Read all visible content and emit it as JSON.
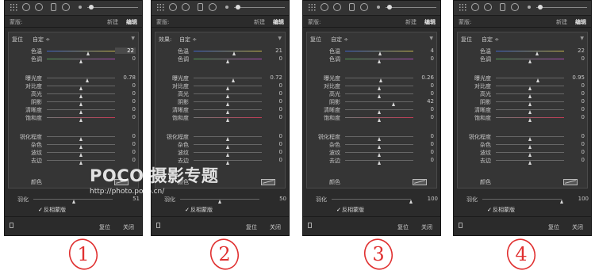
{
  "watermark": {
    "brand": "POCO 摄影专题",
    "url": "http://photo.poco.cn/"
  },
  "labels": {
    "mode": "蒙版:",
    "new": "新建",
    "edit": "编辑",
    "color": "颜色",
    "feather": "羽化",
    "invert": "反相蒙版",
    "reset": "复位",
    "close": "关闭",
    "dropdown": "自定 ÷"
  },
  "annotations": [
    "1",
    "2",
    "3",
    "4"
  ],
  "colors": {
    "panel_bg": "#2b2b2b",
    "effect_bg": "#353535",
    "annotation_red": "#e03030"
  },
  "panels": [
    {
      "effect_label": "复位",
      "effect_value": "自定 ÷",
      "sliders": [
        {
          "label": "色温",
          "value": "22",
          "pos": 0.61
        },
        {
          "label": "色调",
          "value": "0",
          "pos": 0.5
        },
        {
          "label": "曝光度",
          "value": "0.78",
          "pos": 0.6
        },
        {
          "label": "对比度",
          "value": "0",
          "pos": 0.5
        },
        {
          "label": "高光",
          "value": "0",
          "pos": 0.5
        },
        {
          "label": "阴影",
          "value": "0",
          "pos": 0.5
        },
        {
          "label": "清晰度",
          "value": "0",
          "pos": 0.5
        },
        {
          "label": "饱和度",
          "value": "0",
          "pos": 0.5
        },
        {
          "label": "锐化程度",
          "value": "0",
          "pos": 0.5
        },
        {
          "label": "杂色",
          "value": "0",
          "pos": 0.5
        },
        {
          "label": "波纹",
          "value": "0",
          "pos": 0.5
        },
        {
          "label": "去边",
          "value": "0",
          "pos": 0.5
        }
      ],
      "feather": {
        "value": "51",
        "pos": 0.51
      }
    },
    {
      "effect_label": "效果:",
      "effect_value": "自定 ÷",
      "sliders": [
        {
          "label": "色温",
          "value": "21",
          "pos": 0.6
        },
        {
          "label": "色调",
          "value": "0",
          "pos": 0.5
        },
        {
          "label": "曝光度",
          "value": "0.72",
          "pos": 0.59
        },
        {
          "label": "对比度",
          "value": "0",
          "pos": 0.5
        },
        {
          "label": "高光",
          "value": "0",
          "pos": 0.5
        },
        {
          "label": "阴影",
          "value": "0",
          "pos": 0.5
        },
        {
          "label": "清晰度",
          "value": "0",
          "pos": 0.5
        },
        {
          "label": "饱和度",
          "value": "0",
          "pos": 0.5
        },
        {
          "label": "锐化程度",
          "value": "0",
          "pos": 0.5
        },
        {
          "label": "杂色",
          "value": "0",
          "pos": 0.5
        },
        {
          "label": "波纹",
          "value": "0",
          "pos": 0.5
        },
        {
          "label": "去边",
          "value": "0",
          "pos": 0.5
        }
      ],
      "feather": {
        "value": "50",
        "pos": 0.5
      }
    },
    {
      "effect_label": "复位",
      "effect_value": "自定 ÷",
      "sliders": [
        {
          "label": "色温",
          "value": "4",
          "pos": 0.52
        },
        {
          "label": "色调",
          "value": "0",
          "pos": 0.5
        },
        {
          "label": "曝光度",
          "value": "0.26",
          "pos": 0.53
        },
        {
          "label": "对比度",
          "value": "0",
          "pos": 0.5
        },
        {
          "label": "高光",
          "value": "0",
          "pos": 0.5
        },
        {
          "label": "阴影",
          "value": "42",
          "pos": 0.71
        },
        {
          "label": "清晰度",
          "value": "0",
          "pos": 0.5
        },
        {
          "label": "饱和度",
          "value": "0",
          "pos": 0.5
        },
        {
          "label": "锐化程度",
          "value": "0",
          "pos": 0.5
        },
        {
          "label": "杂色",
          "value": "0",
          "pos": 0.5
        },
        {
          "label": "波纹",
          "value": "0",
          "pos": 0.5
        },
        {
          "label": "去边",
          "value": "0",
          "pos": 0.5
        }
      ],
      "feather": {
        "value": "100",
        "pos": 1.0
      }
    },
    {
      "effect_label": "复位",
      "effect_value": "自定 ÷",
      "sliders": [
        {
          "label": "色温",
          "value": "22",
          "pos": 0.61
        },
        {
          "label": "色调",
          "value": "0",
          "pos": 0.5
        },
        {
          "label": "曝光度",
          "value": "0.95",
          "pos": 0.62
        },
        {
          "label": "对比度",
          "value": "0",
          "pos": 0.5
        },
        {
          "label": "高光",
          "value": "0",
          "pos": 0.5
        },
        {
          "label": "阴影",
          "value": "0",
          "pos": 0.5
        },
        {
          "label": "清晰度",
          "value": "0",
          "pos": 0.5
        },
        {
          "label": "饱和度",
          "value": "0",
          "pos": 0.5
        },
        {
          "label": "锐化程度",
          "value": "0",
          "pos": 0.5
        },
        {
          "label": "杂色",
          "value": "0",
          "pos": 0.5
        },
        {
          "label": "波纹",
          "value": "0",
          "pos": 0.5
        },
        {
          "label": "去边",
          "value": "0",
          "pos": 0.5
        }
      ],
      "feather": {
        "value": "100",
        "pos": 1.0
      }
    }
  ]
}
